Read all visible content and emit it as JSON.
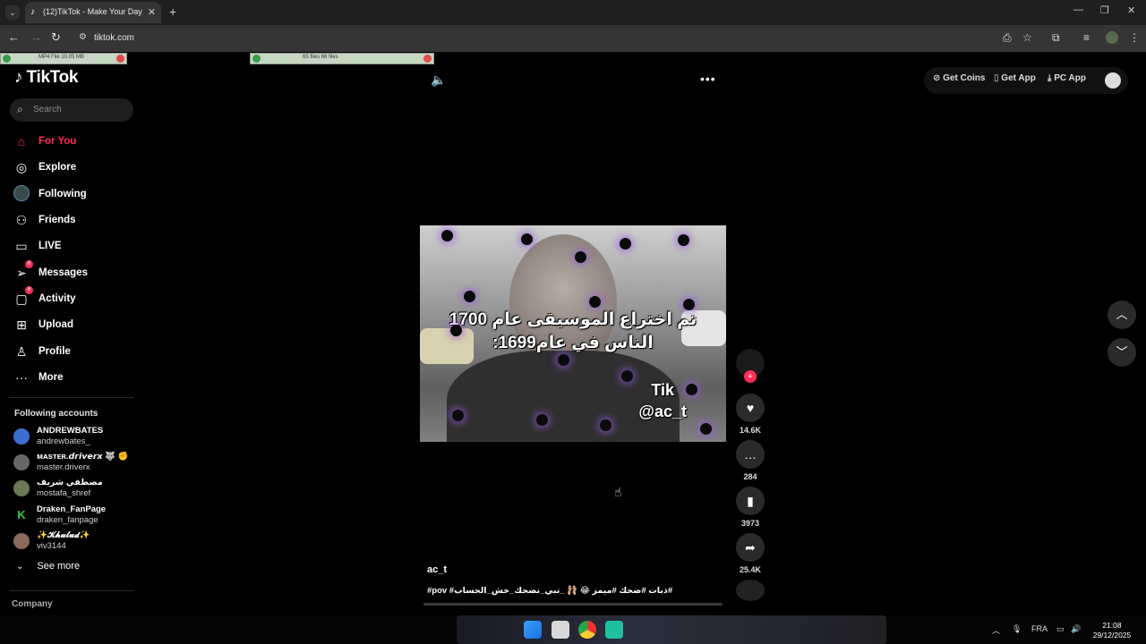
{
  "browser": {
    "tab_title": "(12)TikTok - Make Your Day",
    "url": "tiktok.com",
    "downloads": [
      {
        "text": "MP4 File 10.05 MB"
      },
      {
        "text": "65 files     68 files"
      }
    ]
  },
  "sidebar": {
    "logo": "TikTok",
    "search_placeholder": "Search",
    "nav": [
      {
        "label": "For You"
      },
      {
        "label": "Explore"
      },
      {
        "label": "Following"
      },
      {
        "label": "Friends"
      },
      {
        "label": "LIVE"
      },
      {
        "label": "Messages",
        "badge": "6"
      },
      {
        "label": "Activity",
        "badge": "6"
      },
      {
        "label": "Upload"
      },
      {
        "label": "Profile"
      },
      {
        "label": "More"
      }
    ],
    "following_title": "Following accounts",
    "accounts": [
      {
        "name": "ANDREWBATES",
        "handle": "andrewbates_"
      },
      {
        "name": "ᴍᴀsᴛᴇʀ.𝙙𝙧𝙞𝙫𝙚𝙧𝙭 🐺 ✊",
        "handle": "master.driverx"
      },
      {
        "name": "مصطفي شريف",
        "handle": "mostafa_shref"
      },
      {
        "name": "Draken_FanPage",
        "handle": "draken_fanpage"
      },
      {
        "name": "✨𝓚𝓱𝓾𝓵𝓾𝓭✨",
        "handle": "viv3144"
      }
    ],
    "see_more": "See more",
    "company": "Company"
  },
  "header": {
    "get_coins": "Get Coins",
    "get_app": "Get App",
    "pc_app": "PC App"
  },
  "video": {
    "caption_line1": "تم اختراع الموسيقى عام 1700",
    "caption_line2": "الناس في عام1699:",
    "watermark_line1": "Tik",
    "watermark_line2": "@ac_t",
    "author": "ac_t",
    "description": "#pov #ذبات #ضحك #ميمز 😂 🩰 _تبي_تضحك_خش_الحساب#",
    "likes": "14.6K",
    "comments": "284",
    "saves": "3973",
    "shares": "25.4K"
  },
  "taskbar": {
    "lang": "FRA",
    "time": "21:08",
    "date": "29/12/2025"
  }
}
